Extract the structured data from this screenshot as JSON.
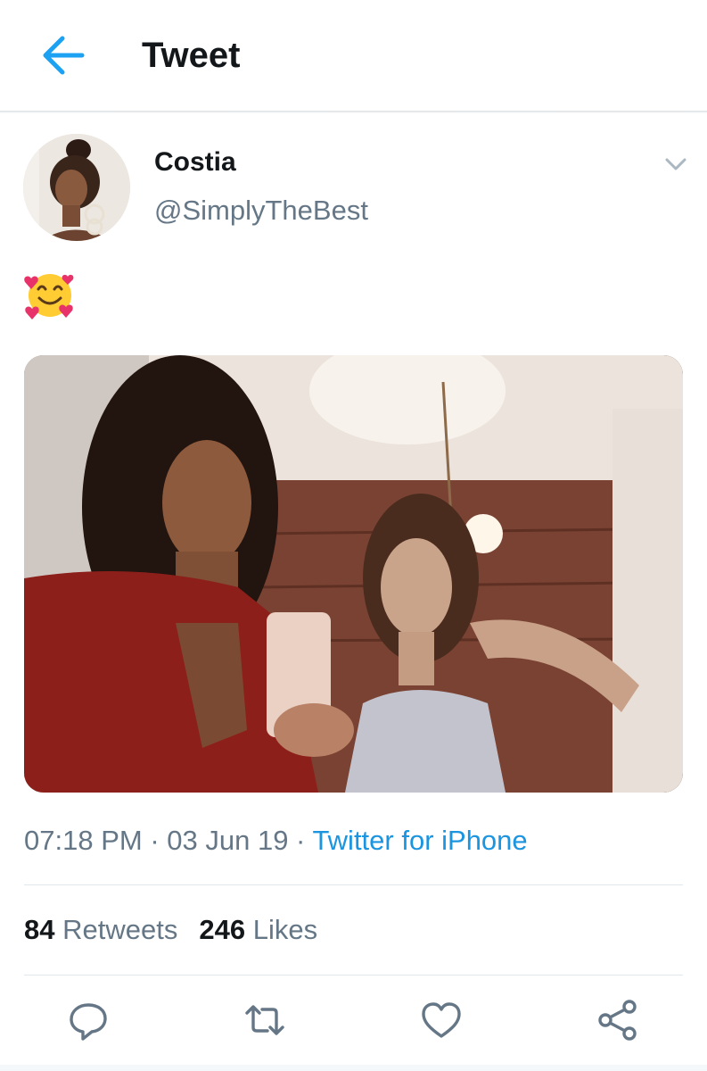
{
  "header": {
    "title": "Tweet",
    "back_icon": "arrow-left-icon"
  },
  "tweet": {
    "author": {
      "name": "Costia",
      "handle": "@SimplyTheBest"
    },
    "text": "🥰",
    "time": "07:18 PM",
    "date": "03 Jun 19",
    "source": "Twitter for iPhone",
    "separator": " · ",
    "stats": {
      "retweets_count": "84",
      "retweets_label": "Retweets",
      "likes_count": "246",
      "likes_label": "Likes"
    }
  },
  "actions": {
    "icons": [
      "reply-icon",
      "retweet-icon",
      "like-icon",
      "share-icon"
    ]
  },
  "colors": {
    "accent": "#1da1f2",
    "link": "#1b95e0",
    "text_primary": "#14171a",
    "text_secondary": "#657786",
    "divider": "#e1e8ed"
  }
}
